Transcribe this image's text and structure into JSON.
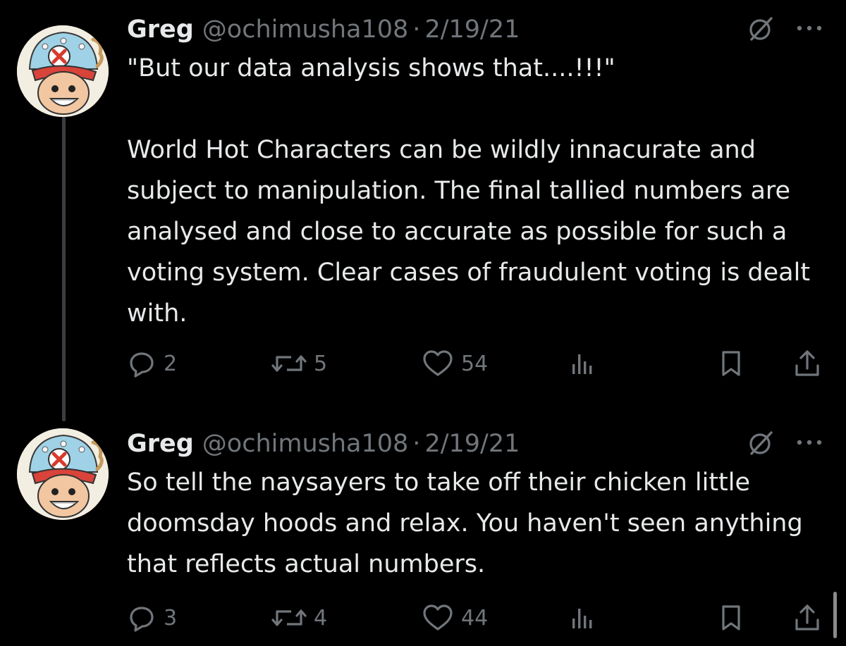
{
  "colors": {
    "background": "#000000",
    "text": "#e7e9ea",
    "muted": "#71767b",
    "thread_line": "#3a3d41"
  },
  "icons": {
    "reply": "speech-bubble-icon",
    "repost": "repost-arrows-icon",
    "like": "heart-icon",
    "views": "bar-chart-icon",
    "bookmark": "bookmark-icon",
    "share": "share-upload-icon",
    "grok": "grok-slash-icon",
    "more": "ellipsis-icon"
  },
  "tweets": [
    {
      "name": "Greg",
      "handle": "@ochimusha108",
      "separator": "·",
      "date": "2/19/21",
      "text_lines": [
        "\"But our data analysis shows that....!!!\"",
        "World Hot Characters can be wildly innacurate and subject to manipulation. The final tallied numbers are analysed and close to accurate as possible for such a voting system. Clear cases of fraudulent voting is dealt with."
      ],
      "replies": "2",
      "reposts": "5",
      "likes": "54"
    },
    {
      "name": "Greg",
      "handle": "@ochimusha108",
      "separator": "·",
      "date": "2/19/21",
      "text_lines": [
        "So tell the naysayers to take off their chicken little doomsday hoods and relax. You haven't seen anything that reflects actual numbers."
      ],
      "replies": "3",
      "reposts": "4",
      "likes": "44"
    }
  ]
}
